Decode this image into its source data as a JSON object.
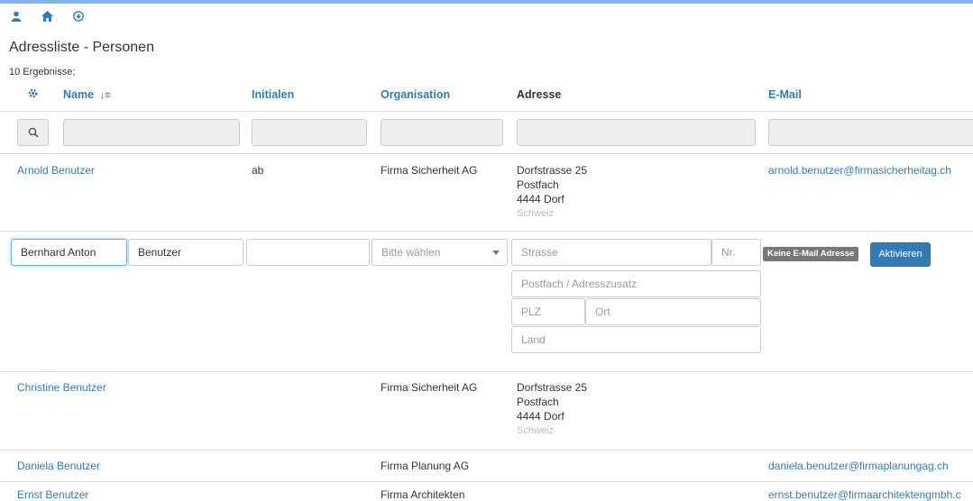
{
  "title": "Adressliste - Personen",
  "results": "10 Ergebnisse;",
  "icons": [
    "user-icon",
    "home-icon",
    "download-icon",
    "gear-icon",
    "sort-icon",
    "search-icon"
  ],
  "columns": {
    "name": "Name",
    "initials": "Initialen",
    "organisation": "Organisation",
    "address": "Adresse",
    "email": "E-Mail"
  },
  "rows": [
    {
      "name": "Arnold Benutzer",
      "initials": "ab",
      "organisation": "Firma Sicherheit AG",
      "address": [
        "Dorfstrasse 25",
        "Postfach",
        "4444 Dorf",
        "Schweiz"
      ],
      "email": "arnold.benutzer@firmasicherheitag.ch"
    },
    {
      "name": "Christine Benutzer",
      "initials": "",
      "organisation": "Firma Sicherheit AG",
      "address": [
        "Dorfstrasse 25",
        "Postfach",
        "4444 Dorf",
        "Schweiz"
      ],
      "email": ""
    },
    {
      "name": "Daniela Benutzer",
      "initials": "",
      "organisation": "Firma Planung AG",
      "address": [],
      "email": "daniela.benutzer@firmaplanungag.ch"
    },
    {
      "name": "Ernst Benutzer",
      "initials": "",
      "organisation": "Firma Architekten",
      "address": [],
      "email": "ernst.benutzer@firmaarchitektengmbh.c"
    }
  ],
  "edit": {
    "firstname": "Bernhard Anton",
    "lastname": "Benutzer",
    "initials": "",
    "org_placeholder": "Bitte wählen",
    "street_placeholder": "Strasse",
    "nr_placeholder": "Nr.",
    "postbox_placeholder": "Postfach / Adresszusatz",
    "plz_placeholder": "PLZ",
    "city_placeholder": "Ort",
    "country_placeholder": "Land",
    "no_email_badge": "Keine E-Mail Adresse",
    "activate_button": "Aktivieren"
  },
  "colors": {
    "link": "#337ab7",
    "badge": "#777777"
  }
}
